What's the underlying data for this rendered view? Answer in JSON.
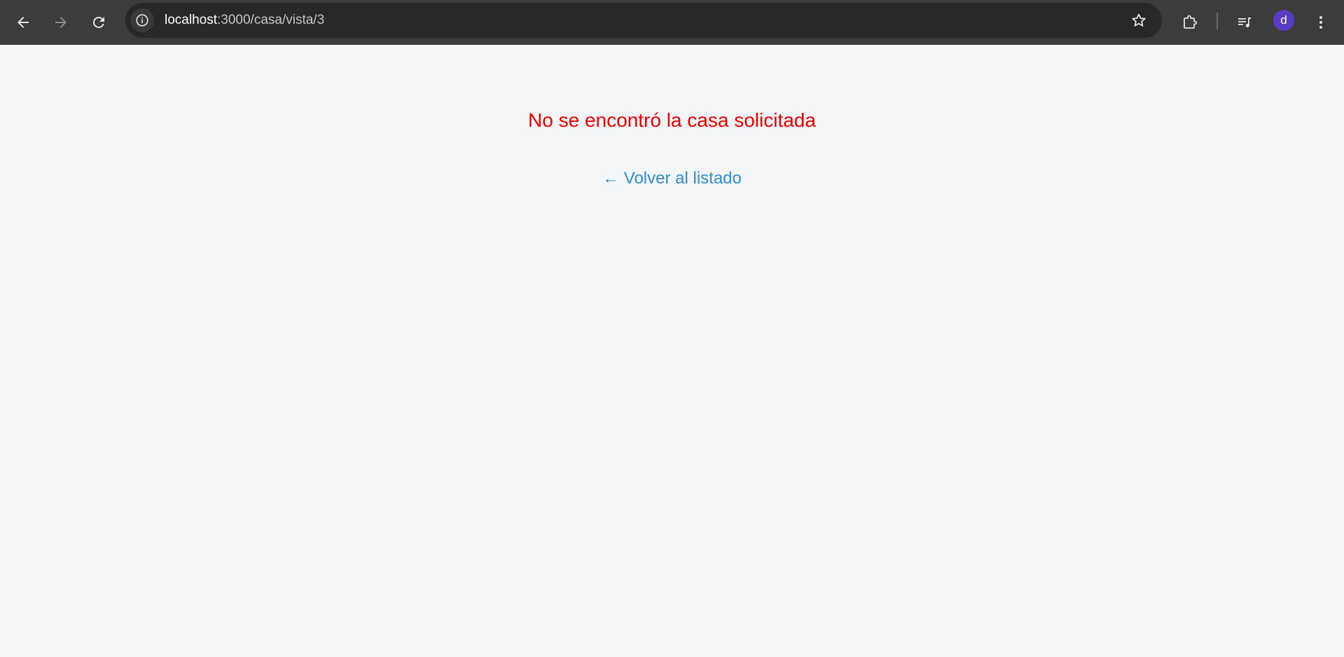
{
  "browser": {
    "url_host": "localhost",
    "url_path": ":3000/casa/vista/3",
    "profile_initial": "d",
    "icons": {
      "back": "arrow-left-icon",
      "forward": "arrow-right-icon",
      "reload": "reload-icon",
      "site_info": "info-icon",
      "bookmark": "star-icon",
      "extensions": "puzzle-icon",
      "media": "media-queue-icon",
      "menu": "kebab-menu-icon"
    },
    "colors": {
      "toolbar": "#3c3c3c",
      "omnibox": "#282828",
      "avatar": "#5b3cc4"
    }
  },
  "page": {
    "error_message": "No se encontró la casa solicitada",
    "back_link": "← Volver al listado",
    "colors": {
      "error": "#ee0000",
      "link": "#2f8fd2",
      "background": "#f4f5f7"
    }
  }
}
